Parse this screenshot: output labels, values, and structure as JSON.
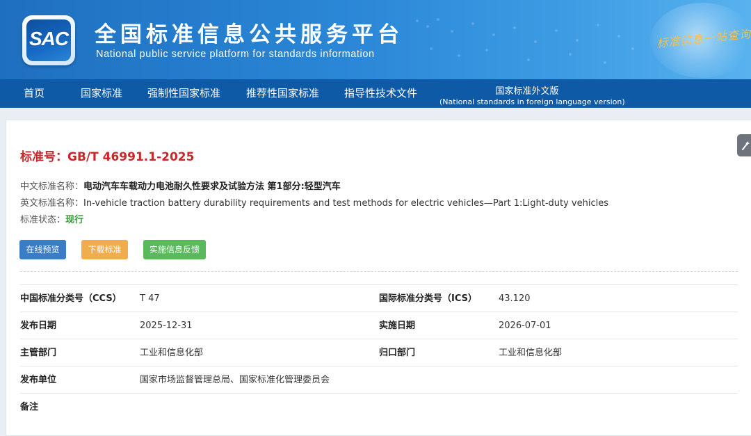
{
  "header": {
    "logo_text": "SAC",
    "title_zh": "全国标准信息公共服务平台",
    "title_en": "National public service platform  for standards information",
    "slogan": "标准信息一站查询"
  },
  "nav": {
    "items": [
      {
        "label": "首页"
      },
      {
        "label": "国家标准"
      },
      {
        "label": "强制性国家标准"
      },
      {
        "label": "推荐性国家标准"
      },
      {
        "label": "指导性技术文件"
      }
    ],
    "foreign": {
      "label": "国家标准外文版",
      "sub": "(National standards in foreign language version)"
    }
  },
  "standard": {
    "number": "标准号：GB/T 46991.1-2025",
    "cn_name_label": "中文标准名称：",
    "cn_name": "电动汽车车载动力电池耐久性要求及试验方法 第1部分:轻型汽车",
    "en_name_label": "英文标准名称：",
    "en_name": "In-vehicle traction battery durability requirements and test methods for electric vehicles—Part 1:Light-duty vehicles",
    "status_label": "标准状态：",
    "status": "现行"
  },
  "buttons": {
    "preview": "在线预览",
    "download": "下载标准",
    "feedback": "实施信息反馈"
  },
  "details": {
    "ccs_label": "中国标准分类号（CCS）",
    "ccs": "T 47",
    "ics_label": "国际标准分类号（ICS）",
    "ics": "43.120",
    "publish_label": "发布日期",
    "publish": "2025-12-31",
    "implement_label": "实施日期",
    "implement": "2026-07-01",
    "dept_label": "主管部门",
    "dept": "工业和信息化部",
    "central_label": "归口部门",
    "central": "工业和信息化部",
    "issuer_label": "发布单位",
    "issuer": "国家市场监督管理总局、国家标准化管理委员会",
    "remark_label": "备注",
    "remark": ""
  }
}
